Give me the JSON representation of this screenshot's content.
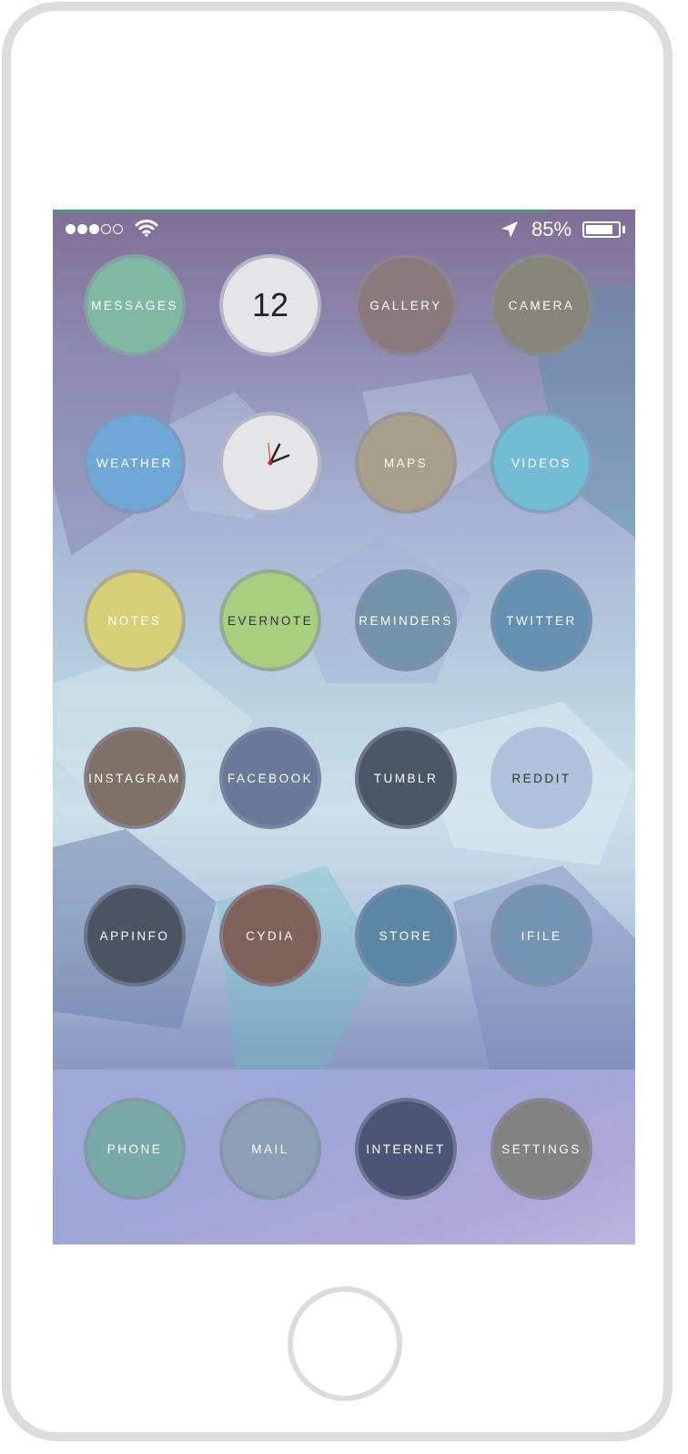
{
  "status_bar": {
    "signal_dots_filled": 3,
    "signal_dots_total": 5,
    "battery_text": "85%",
    "battery_level": 0.85,
    "icons": [
      "wifi-icon",
      "location-arrow-icon",
      "battery-icon"
    ]
  },
  "page_progress": 0.85,
  "apps": {
    "row1": [
      {
        "label": "MESSAGES",
        "color": "#7fb8a3"
      },
      {
        "label": "12",
        "color": "#e5e5e8",
        "type": "date"
      },
      {
        "label": "GALLERY",
        "color": "#8a7a7e"
      },
      {
        "label": "CAMERA",
        "color": "#85857a"
      }
    ],
    "row2": [
      {
        "label": "WEATHER",
        "color": "#6fa8d6"
      },
      {
        "label": "",
        "color": "#e5e5e8",
        "type": "clock"
      },
      {
        "label": "MAPS",
        "color": "#a9a08c"
      },
      {
        "label": "VIDEOS",
        "color": "#73bcd6"
      }
    ],
    "row3": [
      {
        "label": "NOTES",
        "color": "#d6cf78"
      },
      {
        "label": "EVERNOTE",
        "color": "#a6cf80"
      },
      {
        "label": "REMINDERS",
        "color": "#7394a8"
      },
      {
        "label": "TWITTER",
        "color": "#6490b4"
      }
    ],
    "row4": [
      {
        "label": "INSTAGRAM",
        "color": "#7e7267"
      },
      {
        "label": "FACEBOOK",
        "color": "#69799a"
      },
      {
        "label": "TUMBLR",
        "color": "#4a5766"
      },
      {
        "label": "REDDIT",
        "color": "#aec3db"
      }
    ],
    "row5": [
      {
        "label": "APPINFO",
        "color": "#4b5463"
      },
      {
        "label": "CYDIA",
        "color": "#7e6259"
      },
      {
        "label": "STORE",
        "color": "#5b87a4"
      },
      {
        "label": "IFILE",
        "color": "#7594b4"
      }
    ]
  },
  "dock": [
    {
      "label": "PHONE",
      "color": "#79aaa7"
    },
    {
      "label": "MAIL",
      "color": "#8ba0b6"
    },
    {
      "label": "INTERNET",
      "color": "#4b5675"
    },
    {
      "label": "SETTINGS",
      "color": "#818181"
    }
  ]
}
